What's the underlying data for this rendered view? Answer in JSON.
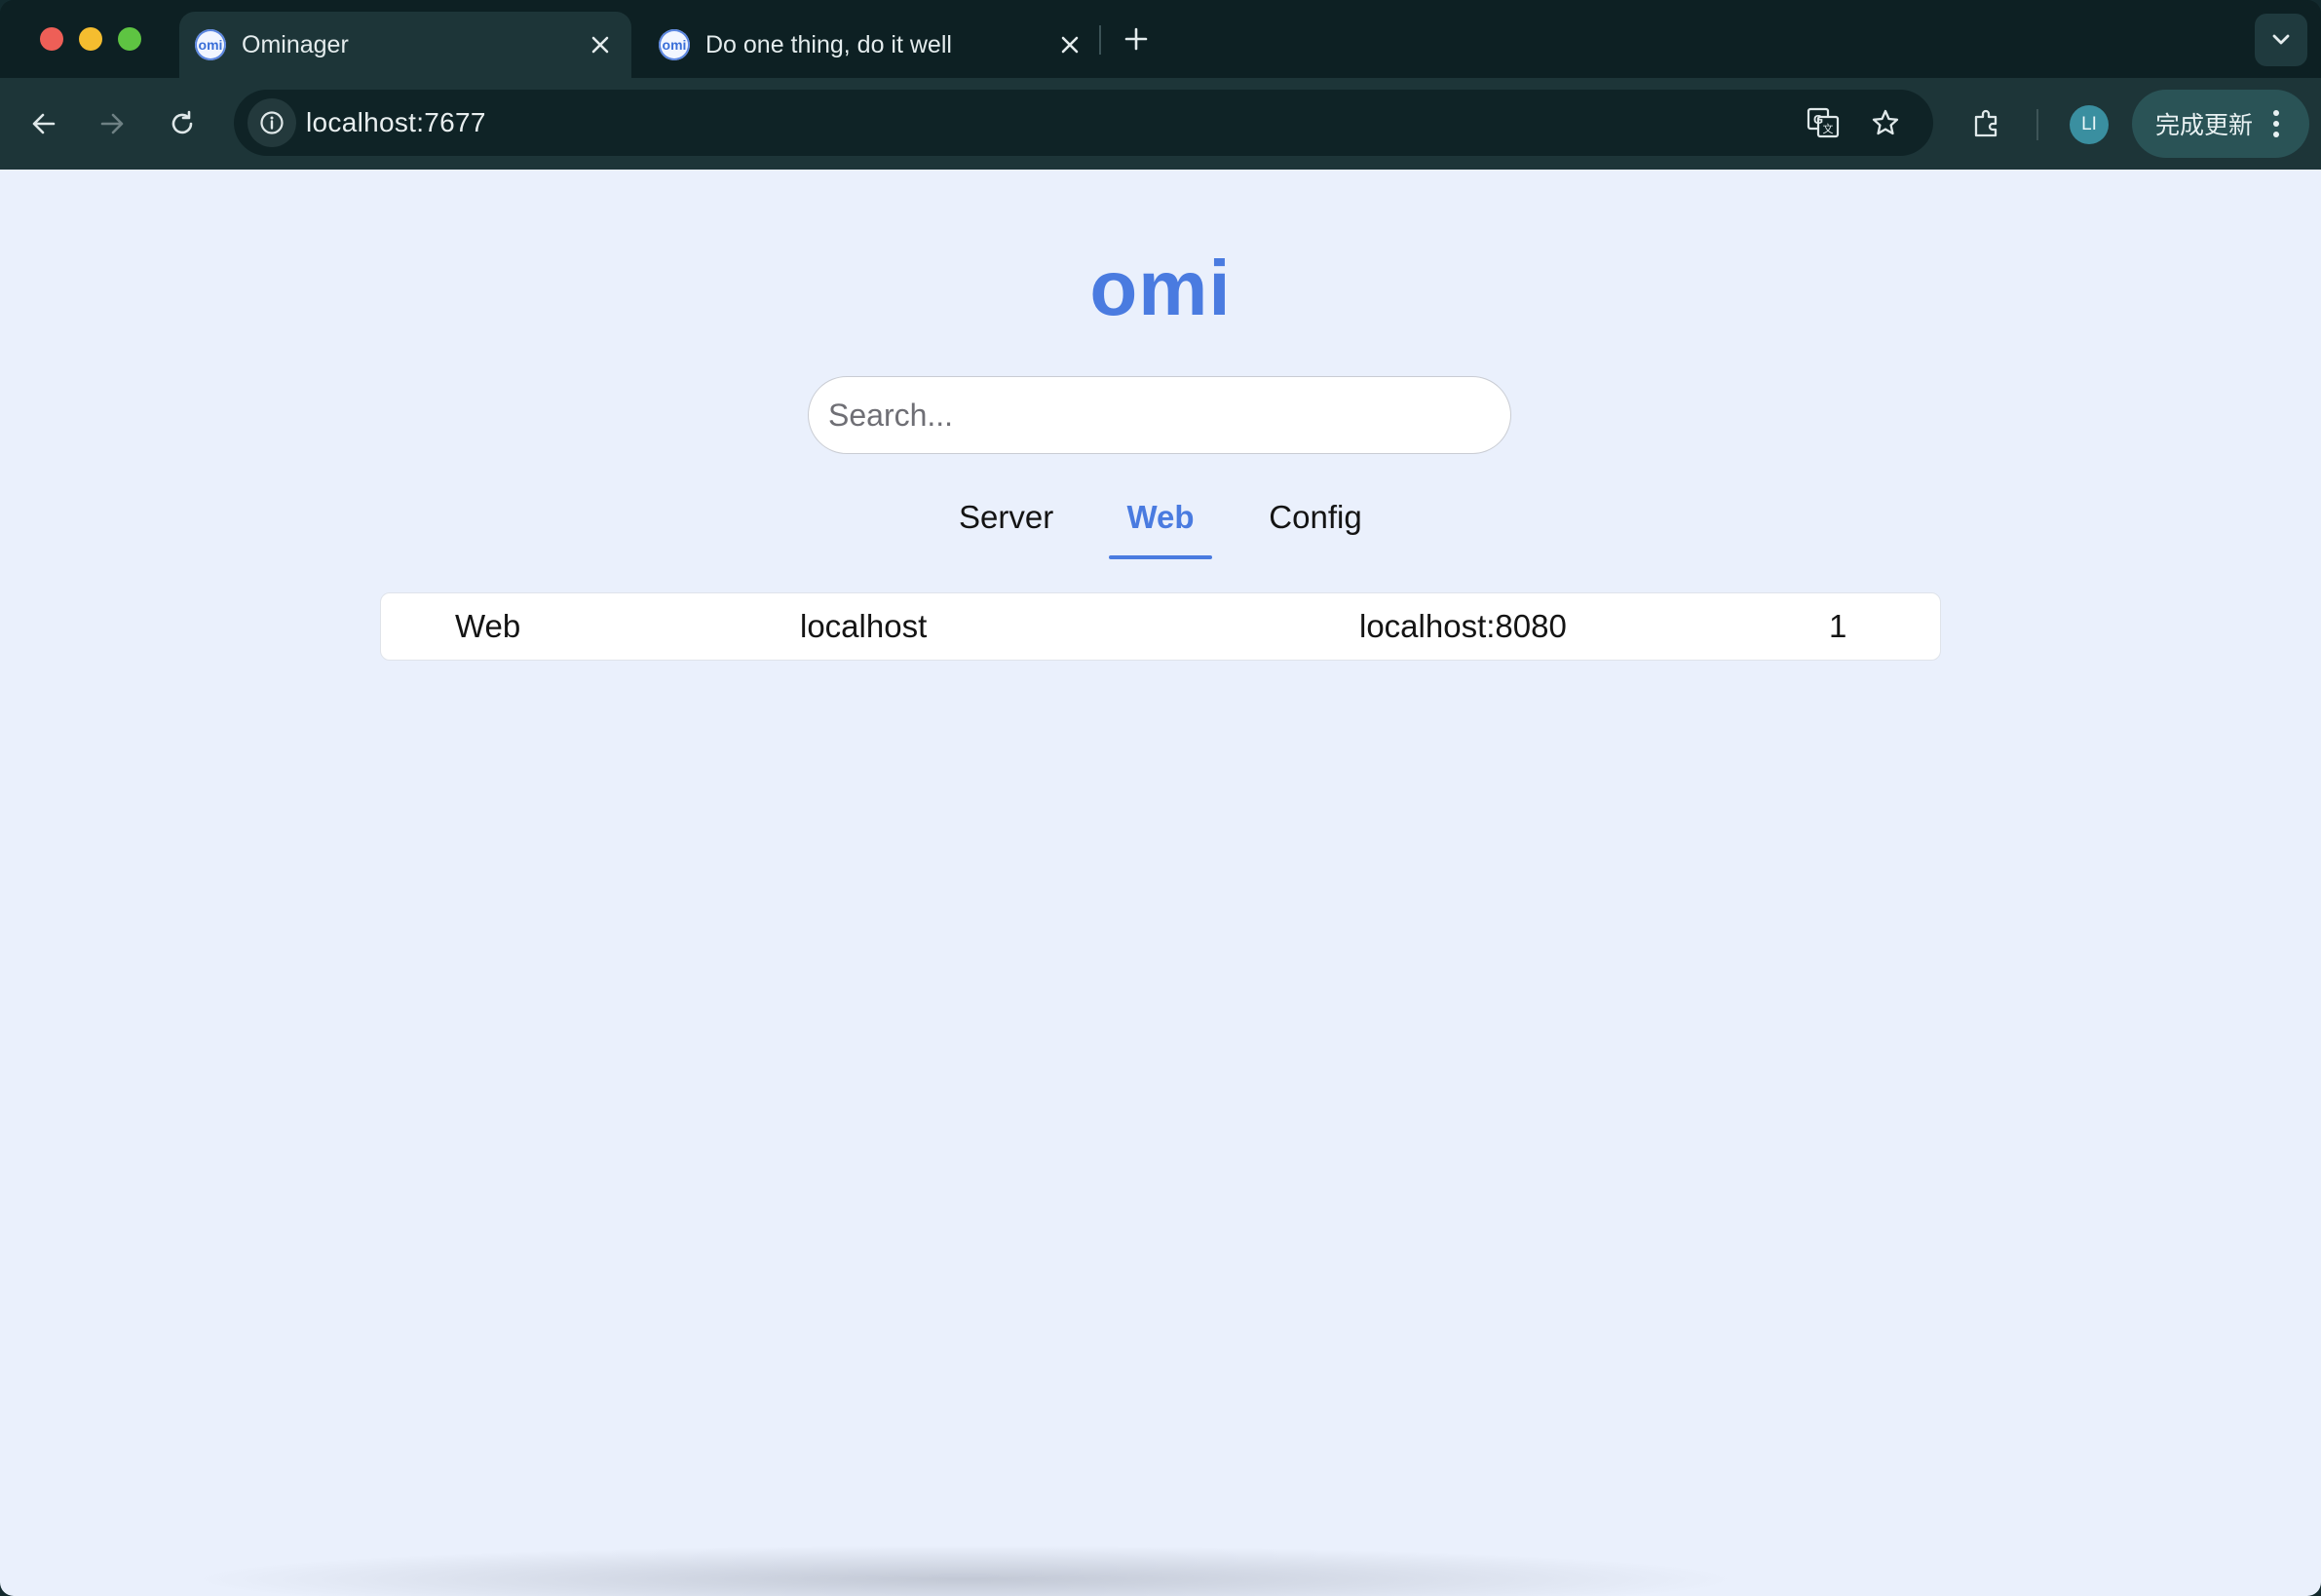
{
  "browser": {
    "tabs": [
      {
        "title": "Ominager",
        "favicon": "omi",
        "active": true
      },
      {
        "title": "Do one thing, do it well",
        "favicon": "omi",
        "active": false
      }
    ],
    "address_bar": {
      "url": "localhost:7677"
    },
    "update_button": {
      "label": "完成更新"
    },
    "profile": {
      "initials": "LI"
    },
    "icons": [
      "back-icon",
      "forward-icon",
      "reload-icon",
      "site-info-icon",
      "translate-icon",
      "bookmark-star-icon",
      "extensions-icon",
      "more-menu-icon",
      "tab-search-icon",
      "new-tab-icon",
      "close-tab-icon"
    ]
  },
  "page": {
    "brand": "omi",
    "search": {
      "placeholder": "Search...",
      "value": ""
    },
    "tabs": [
      {
        "label": "Server",
        "active": false
      },
      {
        "label": "Web",
        "active": true
      },
      {
        "label": "Config",
        "active": false
      }
    ],
    "rows": [
      {
        "type": "Web",
        "name": "localhost",
        "address": "localhost:8080",
        "count": "1"
      }
    ]
  },
  "colors": {
    "accent": "#4a7be0",
    "page_background": "#eaf0fc",
    "browser_chrome": "#1d3538"
  }
}
